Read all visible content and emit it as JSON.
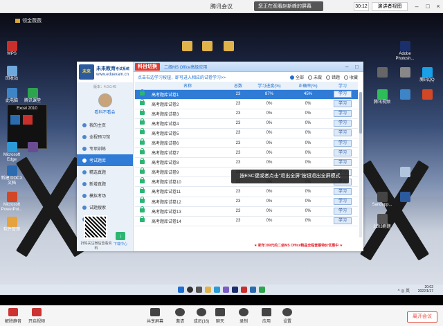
{
  "meeting": {
    "title": "腾讯会议",
    "share_status": "您正在观看赵新峰的屏幕",
    "timer": "30:12",
    "speaker_view": "演讲者视图",
    "leave_label": "离开会议"
  },
  "desktop": {
    "top_label": "领金薇薇",
    "excel_label": "Excel 2010",
    "icons_left": [
      "回收站",
      "此电脑",
      "腾讯课堂",
      "Microsoft Edge",
      "新建 DOCX 文档",
      "Microsoft PowerPoi...",
      "软件管理"
    ],
    "icons_right": [
      "Adobe Photosh...",
      "腾讯QQ",
      "腾讯视频",
      "2103刷题",
      "Sandapp..."
    ],
    "folder_icons": [
      "文件夹",
      "文件夹",
      "文件夹"
    ]
  },
  "app": {
    "brand": "未来教育",
    "brand_sub": "考试系统",
    "url": "www.eduexam.cn",
    "version": "版本：4.0.0.45",
    "username": "看科不看会",
    "subject_switch": "科目切换",
    "subject_name": "二级MS Office高级应用",
    "hint": "点击右边学习按钮，即可进入相应的试卷学习>>",
    "filters": [
      {
        "label": "全部",
        "on": true
      },
      {
        "label": "未做",
        "on": false
      },
      {
        "label": "错题",
        "on": false
      },
      {
        "label": "收藏",
        "on": false
      }
    ],
    "nav": [
      {
        "label": "我的主页",
        "active": false
      },
      {
        "label": "全程预习馆",
        "active": false
      },
      {
        "label": "专项训练",
        "active": false
      },
      {
        "label": "考试题库",
        "active": true
      },
      {
        "label": "精选真题",
        "active": false
      },
      {
        "label": "新增真题",
        "active": false
      },
      {
        "label": "模拟考场",
        "active": false
      },
      {
        "label": "试题搜索",
        "active": false
      },
      {
        "label": "错题笔记",
        "active": false
      }
    ],
    "qr_label": "扫码关注微信查看资料",
    "download_label": "下载中心",
    "columns": [
      "",
      "名称",
      "总数",
      "学习进度(%)",
      "正确率(%)",
      "学习"
    ],
    "rows": [
      {
        "name": "高考题库试卷1",
        "total": "23",
        "progress": "87%",
        "accuracy": "45%",
        "action": "学习",
        "sel": true
      },
      {
        "name": "高考题库试卷2",
        "total": "23",
        "progress": "0%",
        "accuracy": "0%",
        "action": "学习",
        "sel": false
      },
      {
        "name": "高考题库试卷3",
        "total": "23",
        "progress": "0%",
        "accuracy": "0%",
        "action": "学习",
        "sel": false
      },
      {
        "name": "高考题库试卷4",
        "total": "23",
        "progress": "0%",
        "accuracy": "0%",
        "action": "学习",
        "sel": false
      },
      {
        "name": "高考题库试卷5",
        "total": "23",
        "progress": "0%",
        "accuracy": "0%",
        "action": "学习",
        "sel": false
      },
      {
        "name": "高考题库试卷6",
        "total": "23",
        "progress": "0%",
        "accuracy": "0%",
        "action": "学习",
        "sel": false
      },
      {
        "name": "高考题库试卷7",
        "total": "23",
        "progress": "0%",
        "accuracy": "0%",
        "action": "学习",
        "sel": false
      },
      {
        "name": "高考题库试卷8",
        "total": "23",
        "progress": "0%",
        "accuracy": "0%",
        "action": "学习",
        "sel": false
      },
      {
        "name": "高考题库试卷9",
        "total": "23",
        "progress": "0%",
        "accuracy": "0%",
        "action": "学习",
        "sel": false
      },
      {
        "name": "高考题库试卷10",
        "total": "23",
        "progress": "0%",
        "accuracy": "0%",
        "action": "学习",
        "sel": false
      },
      {
        "name": "高考题库试卷11",
        "total": "23",
        "progress": "0%",
        "accuracy": "0%",
        "action": "学习",
        "sel": false
      },
      {
        "name": "高考题库试卷12",
        "total": "23",
        "progress": "0%",
        "accuracy": "0%",
        "action": "学习",
        "sel": false
      },
      {
        "name": "高考题库试卷13",
        "total": "23",
        "progress": "0%",
        "accuracy": "0%",
        "action": "学习",
        "sel": false
      },
      {
        "name": "高考题库试卷14",
        "total": "23",
        "progress": "0%",
        "accuracy": "0%",
        "action": "学习",
        "sel": false
      }
    ],
    "promo": "★ 新年199元的二级MS Office精品全程套餐特价优惠中 ★"
  },
  "toast": "按ESC键或者点击\"退出全屏\"按钮退出全屏模式",
  "taskbar": {
    "time": "20:02",
    "date": "2022/1/17",
    "tray": "^ ◎ 英"
  },
  "toolbar": [
    {
      "label": "解除静音"
    },
    {
      "label": "开启视频"
    },
    {
      "label": "共享屏幕"
    },
    {
      "label": "邀请"
    },
    {
      "label": "成员(16)"
    },
    {
      "label": "聊天"
    },
    {
      "label": "录制"
    },
    {
      "label": "应用"
    },
    {
      "label": "设置"
    }
  ],
  "colors": {
    "accent": "#2f7bd6",
    "leave": "#e64a3b",
    "switch": "#e63c2f"
  }
}
